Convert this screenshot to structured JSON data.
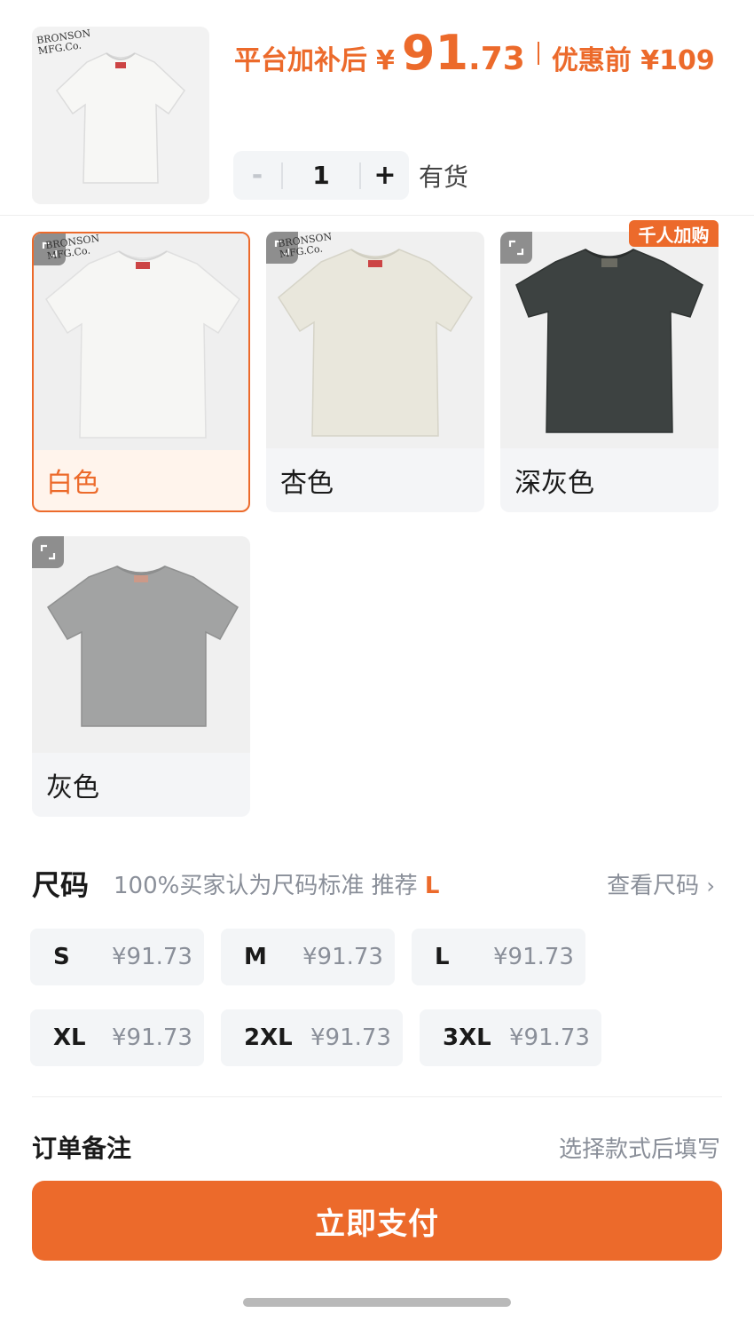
{
  "header": {
    "price_prefix": "平台加补后",
    "currency": "¥",
    "price_integer": "91",
    "price_decimal": ".73",
    "price_before": "优惠前 ¥109",
    "quantity": "1",
    "minus": "-",
    "plus": "+",
    "stock": "有货"
  },
  "colors": [
    {
      "label": "白色",
      "shirt_color": "#f4f4f2",
      "selected": true
    },
    {
      "label": "杏色",
      "shirt_color": "#e9e7dc",
      "selected": false
    },
    {
      "label": "深灰色",
      "shirt_color": "#3d4241",
      "selected": false,
      "badge": "千人加购"
    },
    {
      "label": "灰色",
      "shirt_color": "#a2a3a3",
      "selected": false
    }
  ],
  "brand_logo_text": "BRONSON MFG.Co.",
  "size": {
    "title": "尺码",
    "hint": "100%买家认为尺码标准 推荐",
    "recommended": "L",
    "chart_link": "查看尺码",
    "options": [
      {
        "name": "S",
        "price": "¥91.73"
      },
      {
        "name": "M",
        "price": "¥91.73"
      },
      {
        "name": "L",
        "price": "¥91.73"
      },
      {
        "name": "XL",
        "price": "¥91.73"
      },
      {
        "name": "2XL",
        "price": "¥91.73"
      },
      {
        "name": "3XL",
        "price": "¥91.73"
      }
    ]
  },
  "note": {
    "label": "订单备注",
    "hint": "选择款式后填写"
  },
  "pay_button": "立即支付",
  "accent_color": "#ec6a2b"
}
